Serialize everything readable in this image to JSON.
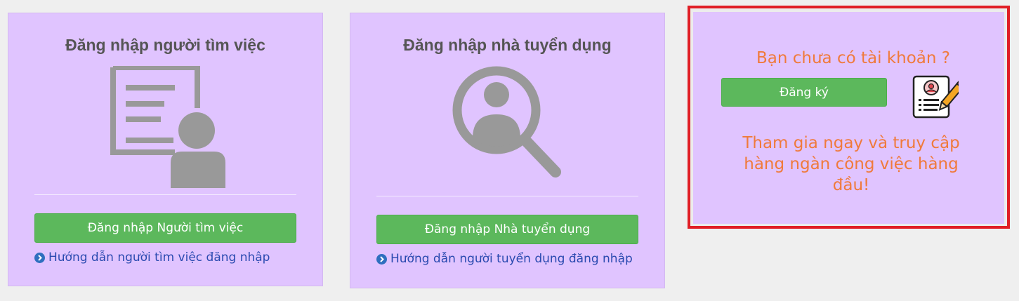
{
  "seeker_card": {
    "title": "Đăng nhập người tìm việc",
    "login_button": "Đăng nhập Người tìm việc",
    "help_link": "Hướng dẫn người tìm việc đăng nhập",
    "illustration": "resume-person-icon"
  },
  "employer_card": {
    "title": "Đăng nhập nhà tuyển dụng",
    "login_button": "Đăng nhập Nhà tuyển dụng",
    "help_link": "Hướng dẫn người tuyển dụng đăng nhập",
    "illustration": "magnifier-person-icon"
  },
  "register_card": {
    "question": "Bạn chưa có tài khoản ?",
    "register_button": "Đăng ký",
    "promo": "Tham gia ngay và truy cập hàng ngàn công việc hàng đầu!",
    "icon": "resume-form-pencil-icon"
  },
  "colors": {
    "card_bg": "#e0c4ff",
    "button_green": "#5cb85c",
    "accent_orange": "#f07a3b",
    "link_blue": "#2a4ab0",
    "highlight_red": "#e01e26"
  }
}
